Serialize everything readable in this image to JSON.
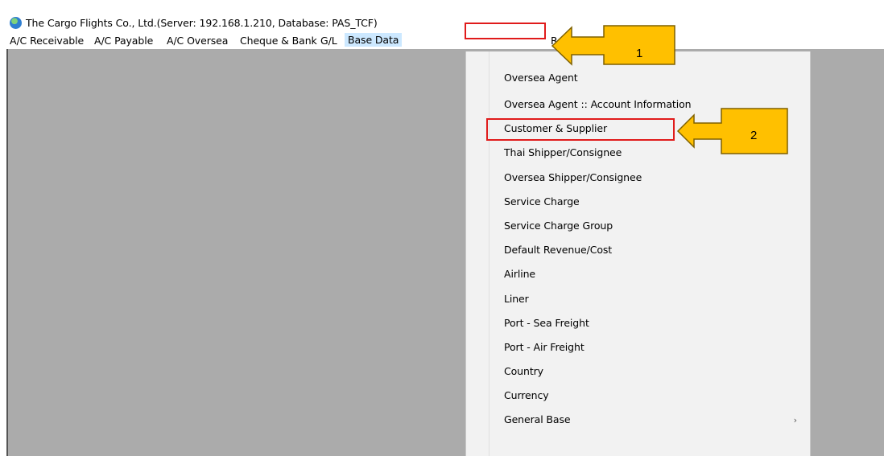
{
  "window": {
    "title": "The Cargo Flights Co., Ltd.(Server: 192.168.1.210,  Database: PAS_TCF)"
  },
  "menubar": {
    "items": [
      {
        "label": "A/C Receivable"
      },
      {
        "label": "A/C Payable"
      },
      {
        "label": "A/C Oversea"
      },
      {
        "label": "Cheque & Bank"
      },
      {
        "label": "G/L"
      },
      {
        "label": "Base Data"
      },
      {
        "label": "R"
      }
    ]
  },
  "dropdown": {
    "items": [
      {
        "label": "Oversea Agent"
      },
      {
        "label": "Oversea Agent :: Account Information"
      },
      {
        "label": "Customer & Supplier"
      },
      {
        "label": "Thai Shipper/Consignee"
      },
      {
        "label": "Oversea Shipper/Consignee"
      },
      {
        "label": "Service Charge"
      },
      {
        "label": "Service Charge Group"
      },
      {
        "label": "Default Revenue/Cost"
      },
      {
        "label": "Airline"
      },
      {
        "label": "Liner"
      },
      {
        "label": "Port - Sea Freight"
      },
      {
        "label": "Port - Air Freight"
      },
      {
        "label": "Country"
      },
      {
        "label": "Currency"
      },
      {
        "label": "General Base"
      }
    ],
    "submenu_glyph": "›"
  },
  "callouts": [
    {
      "number": "1"
    },
    {
      "number": "2"
    }
  ],
  "colors": {
    "callout_fill": "#ffc000",
    "callout_border": "#7f6000",
    "highlight_border": "#e01b1b",
    "menu_selected": "#cce8ff",
    "workspace": "#ababab"
  },
  "icons": {
    "app": "globe-icon",
    "submenu": "chevron-right-icon"
  }
}
